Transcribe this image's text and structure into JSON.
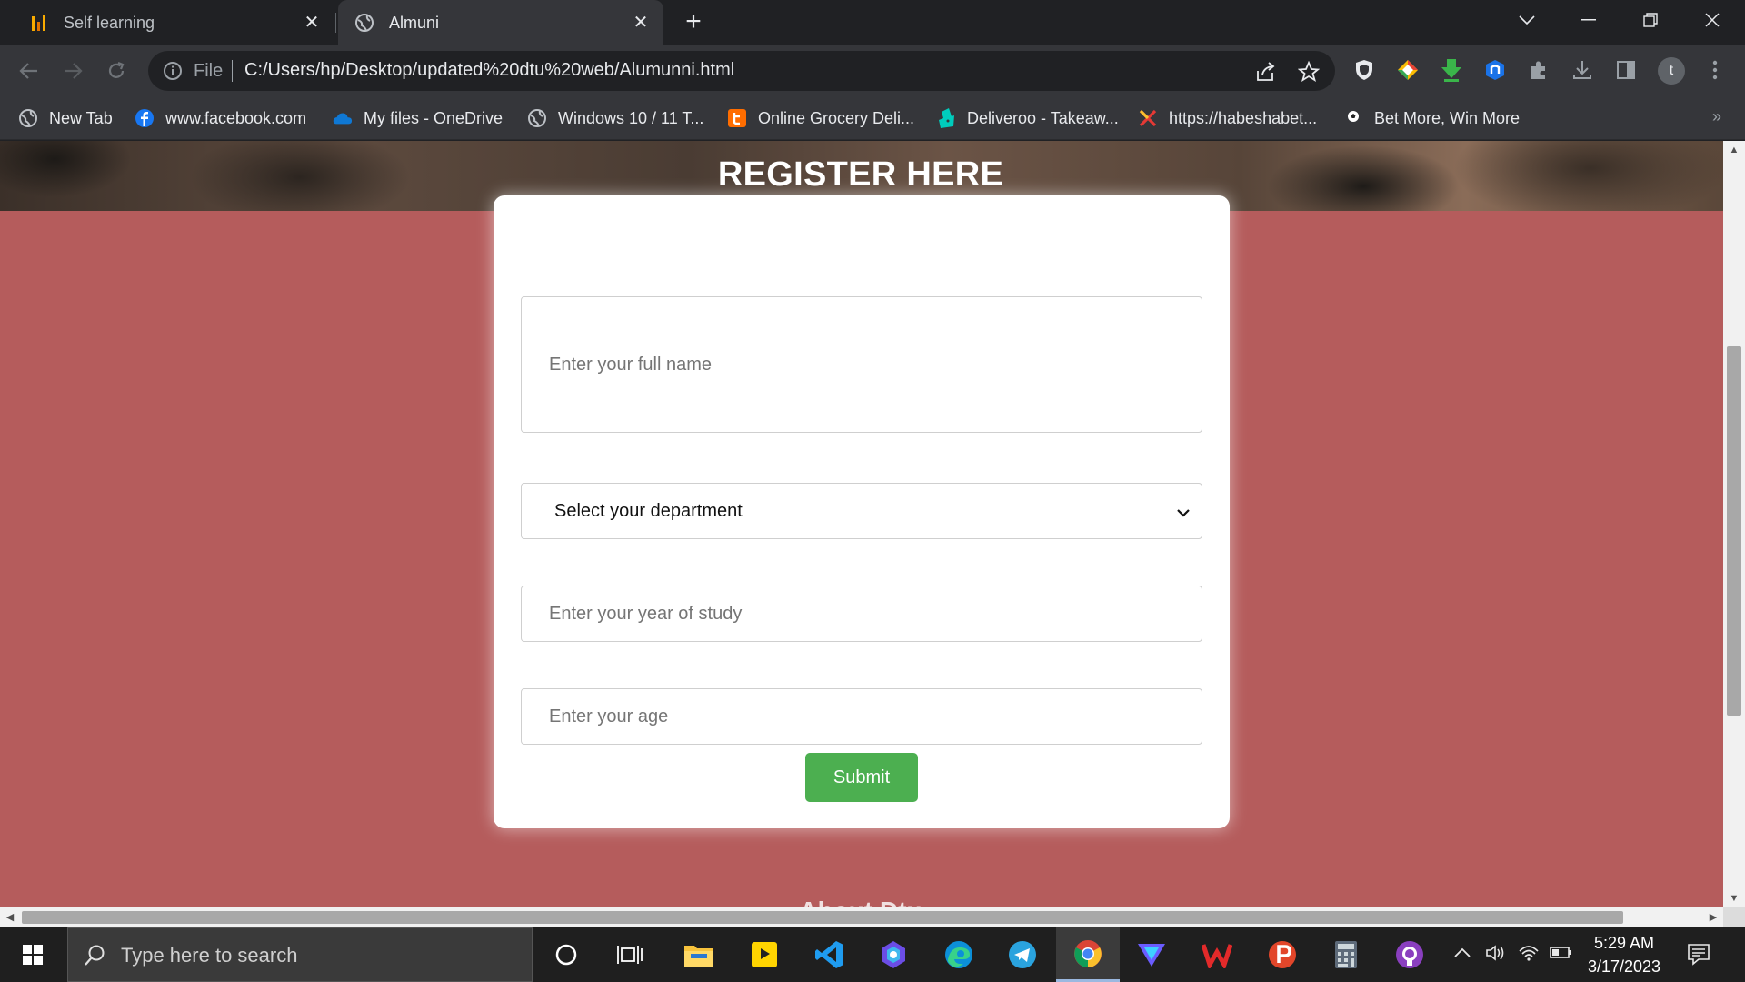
{
  "browser": {
    "tabs": [
      {
        "title": "Self learning",
        "active": false
      },
      {
        "title": "Almuni",
        "active": true
      }
    ],
    "address": {
      "scheme_label": "File",
      "url": "C:/Users/hp/Desktop/updated%20dtu%20web/Alumunni.html"
    },
    "bookmarks": [
      {
        "label": "New Tab",
        "icon": "globe-icon"
      },
      {
        "label": "www.facebook.com",
        "icon": "facebook-icon"
      },
      {
        "label": "My files - OneDrive",
        "icon": "onedrive-icon"
      },
      {
        "label": "Windows 10 / 11 T...",
        "icon": "globe-icon"
      },
      {
        "label": "Online Grocery Deli...",
        "icon": "grocery-icon"
      },
      {
        "label": "Deliveroo - Takeaw...",
        "icon": "deliveroo-icon"
      },
      {
        "label": "https://habeshabet...",
        "icon": "habesha-icon"
      },
      {
        "label": "Bet More, Win More",
        "icon": "soccer-icon"
      }
    ],
    "profile_initial": "t"
  },
  "page": {
    "heading": "REGISTER HERE",
    "form": {
      "name_placeholder": "Enter your full name",
      "department_selected": "Select your department",
      "year_placeholder": "Enter your year of study",
      "age_placeholder": "Enter your age",
      "submit_label": "Submit"
    },
    "next_section_heading": "About Dtu"
  },
  "taskbar": {
    "search_placeholder": "Type here to search",
    "time": "5:29 AM",
    "date": "3/17/2023"
  },
  "colors": {
    "page_background": "#b55c5c",
    "submit_button": "#4caf50",
    "browser_frame": "#202124",
    "toolbar": "#35363a"
  }
}
